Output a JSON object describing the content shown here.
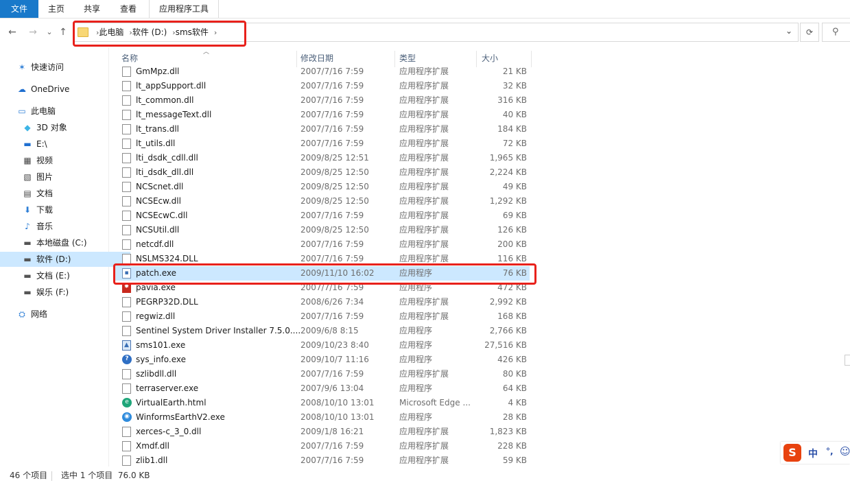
{
  "ribbon": {
    "tabs": [
      {
        "label": "文件"
      },
      {
        "label": "主页"
      },
      {
        "label": "共享"
      },
      {
        "label": "查看"
      },
      {
        "label": "应用程序工具"
      }
    ]
  },
  "nav": {
    "back": "←",
    "forward": "→",
    "recent": "⌄",
    "up": "↑",
    "breadcrumbs": [
      "此电脑",
      "软件 (D:)",
      "sms软件"
    ],
    "dropdown": "⌄",
    "refresh": "⟳",
    "search_icon": "⚲"
  },
  "sidebar": {
    "items": [
      {
        "label": "快速访问",
        "icon": "✶",
        "icon_color": "#2f7fd6"
      },
      {
        "label": "OneDrive",
        "icon": "☁",
        "icon_color": "#1f6fd0"
      },
      {
        "label": "此电脑",
        "icon": "▭",
        "icon_color": "#2f7fd6"
      },
      {
        "label": "3D 对象",
        "icon": "◆",
        "icon_color": "#3db5e6"
      },
      {
        "label": "E:\\",
        "icon": "▬",
        "icon_color": "#1f6fd0"
      },
      {
        "label": "视频",
        "icon": "▦",
        "icon_color": "#444"
      },
      {
        "label": "图片",
        "icon": "▧",
        "icon_color": "#444"
      },
      {
        "label": "文档",
        "icon": "▤",
        "icon_color": "#444"
      },
      {
        "label": "下载",
        "icon": "⬇",
        "icon_color": "#2f7fd6"
      },
      {
        "label": "音乐",
        "icon": "♪",
        "icon_color": "#2f7fd6"
      },
      {
        "label": "本地磁盘 (C:)",
        "icon": "▬",
        "icon_color": "#555"
      },
      {
        "label": "软件 (D:)",
        "icon": "▬",
        "icon_color": "#555"
      },
      {
        "label": "文档 (E:)",
        "icon": "▬",
        "icon_color": "#555"
      },
      {
        "label": "娱乐 (F:)",
        "icon": "▬",
        "icon_color": "#555"
      },
      {
        "label": "网络",
        "icon": "⛭",
        "icon_color": "#2f7fd6"
      }
    ]
  },
  "columns": {
    "name": "名称",
    "date": "修改日期",
    "type": "类型",
    "size": "大小"
  },
  "files": [
    {
      "name": "GmMpz.dll",
      "date": "2007/7/16 7:59",
      "type": "应用程序扩展",
      "size": "21 KB",
      "icon": "dll"
    },
    {
      "name": "lt_appSupport.dll",
      "date": "2007/7/16 7:59",
      "type": "应用程序扩展",
      "size": "32 KB",
      "icon": "dll"
    },
    {
      "name": "lt_common.dll",
      "date": "2007/7/16 7:59",
      "type": "应用程序扩展",
      "size": "316 KB",
      "icon": "dll"
    },
    {
      "name": "lt_messageText.dll",
      "date": "2007/7/16 7:59",
      "type": "应用程序扩展",
      "size": "40 KB",
      "icon": "dll"
    },
    {
      "name": "lt_trans.dll",
      "date": "2007/7/16 7:59",
      "type": "应用程序扩展",
      "size": "184 KB",
      "icon": "dll"
    },
    {
      "name": "lt_utils.dll",
      "date": "2007/7/16 7:59",
      "type": "应用程序扩展",
      "size": "72 KB",
      "icon": "dll"
    },
    {
      "name": "lti_dsdk_cdll.dll",
      "date": "2009/8/25 12:51",
      "type": "应用程序扩展",
      "size": "1,965 KB",
      "icon": "dll"
    },
    {
      "name": "lti_dsdk_dll.dll",
      "date": "2009/8/25 12:50",
      "type": "应用程序扩展",
      "size": "2,224 KB",
      "icon": "dll"
    },
    {
      "name": "NCScnet.dll",
      "date": "2009/8/25 12:50",
      "type": "应用程序扩展",
      "size": "49 KB",
      "icon": "dll"
    },
    {
      "name": "NCSEcw.dll",
      "date": "2009/8/25 12:50",
      "type": "应用程序扩展",
      "size": "1,292 KB",
      "icon": "dll"
    },
    {
      "name": "NCSEcwC.dll",
      "date": "2007/7/16 7:59",
      "type": "应用程序扩展",
      "size": "69 KB",
      "icon": "dll"
    },
    {
      "name": "NCSUtil.dll",
      "date": "2009/8/25 12:50",
      "type": "应用程序扩展",
      "size": "126 KB",
      "icon": "dll"
    },
    {
      "name": "netcdf.dll",
      "date": "2007/7/16 7:59",
      "type": "应用程序扩展",
      "size": "200 KB",
      "icon": "dll"
    },
    {
      "name": "NSLMS324.DLL",
      "date": "2007/7/16 7:59",
      "type": "应用程序扩展",
      "size": "116 KB",
      "icon": "dll"
    },
    {
      "name": "patch.exe",
      "date": "2009/11/10 16:02",
      "type": "应用程序",
      "size": "76 KB",
      "icon": "exe",
      "selected": true
    },
    {
      "name": "pavia.exe",
      "date": "2007/7/16 7:59",
      "type": "应用程序",
      "size": "472 KB",
      "icon": "flag"
    },
    {
      "name": "PEGRP32D.DLL",
      "date": "2008/6/26 7:34",
      "type": "应用程序扩展",
      "size": "2,992 KB",
      "icon": "dll"
    },
    {
      "name": "regwiz.dll",
      "date": "2007/7/16 7:59",
      "type": "应用程序扩展",
      "size": "168 KB",
      "icon": "dll"
    },
    {
      "name": "Sentinel System Driver Installer 7.5.0....",
      "date": "2009/6/8 8:15",
      "type": "应用程序",
      "size": "2,766 KB",
      "icon": "dll"
    },
    {
      "name": "sms101.exe",
      "date": "2009/10/23 8:40",
      "type": "应用程序",
      "size": "27,516 KB",
      "icon": "img"
    },
    {
      "name": "sys_info.exe",
      "date": "2009/10/7 11:16",
      "type": "应用程序",
      "size": "426 KB",
      "icon": "help"
    },
    {
      "name": "szlibdll.dll",
      "date": "2007/7/16 7:59",
      "type": "应用程序扩展",
      "size": "80 KB",
      "icon": "dll"
    },
    {
      "name": "terraserver.exe",
      "date": "2007/9/6 13:04",
      "type": "应用程序",
      "size": "64 KB",
      "icon": "dll"
    },
    {
      "name": "VirtualEarth.html",
      "date": "2008/10/10 13:01",
      "type": "Microsoft Edge ...",
      "size": "4 KB",
      "icon": "edge"
    },
    {
      "name": "WinformsEarthV2.exe",
      "date": "2008/10/10 13:01",
      "type": "应用程序",
      "size": "28 KB",
      "icon": "globe"
    },
    {
      "name": "xerces-c_3_0.dll",
      "date": "2009/1/8 16:21",
      "type": "应用程序扩展",
      "size": "1,823 KB",
      "icon": "dll"
    },
    {
      "name": "Xmdf.dll",
      "date": "2007/7/16 7:59",
      "type": "应用程序扩展",
      "size": "228 KB",
      "icon": "dll"
    },
    {
      "name": "zlib1.dll",
      "date": "2007/7/16 7:59",
      "type": "应用程序扩展",
      "size": "59 KB",
      "icon": "dll"
    }
  ],
  "status": {
    "count": "46 个项目",
    "selection": "选中 1 个项目  76.0 KB"
  },
  "ime": {
    "logo": "S",
    "lang": "中",
    "punct": "°,",
    "emoji": "☺"
  },
  "colors": {
    "accent": "#1979ca",
    "selection": "#cce8ff",
    "highlight_box": "#e8211b"
  }
}
